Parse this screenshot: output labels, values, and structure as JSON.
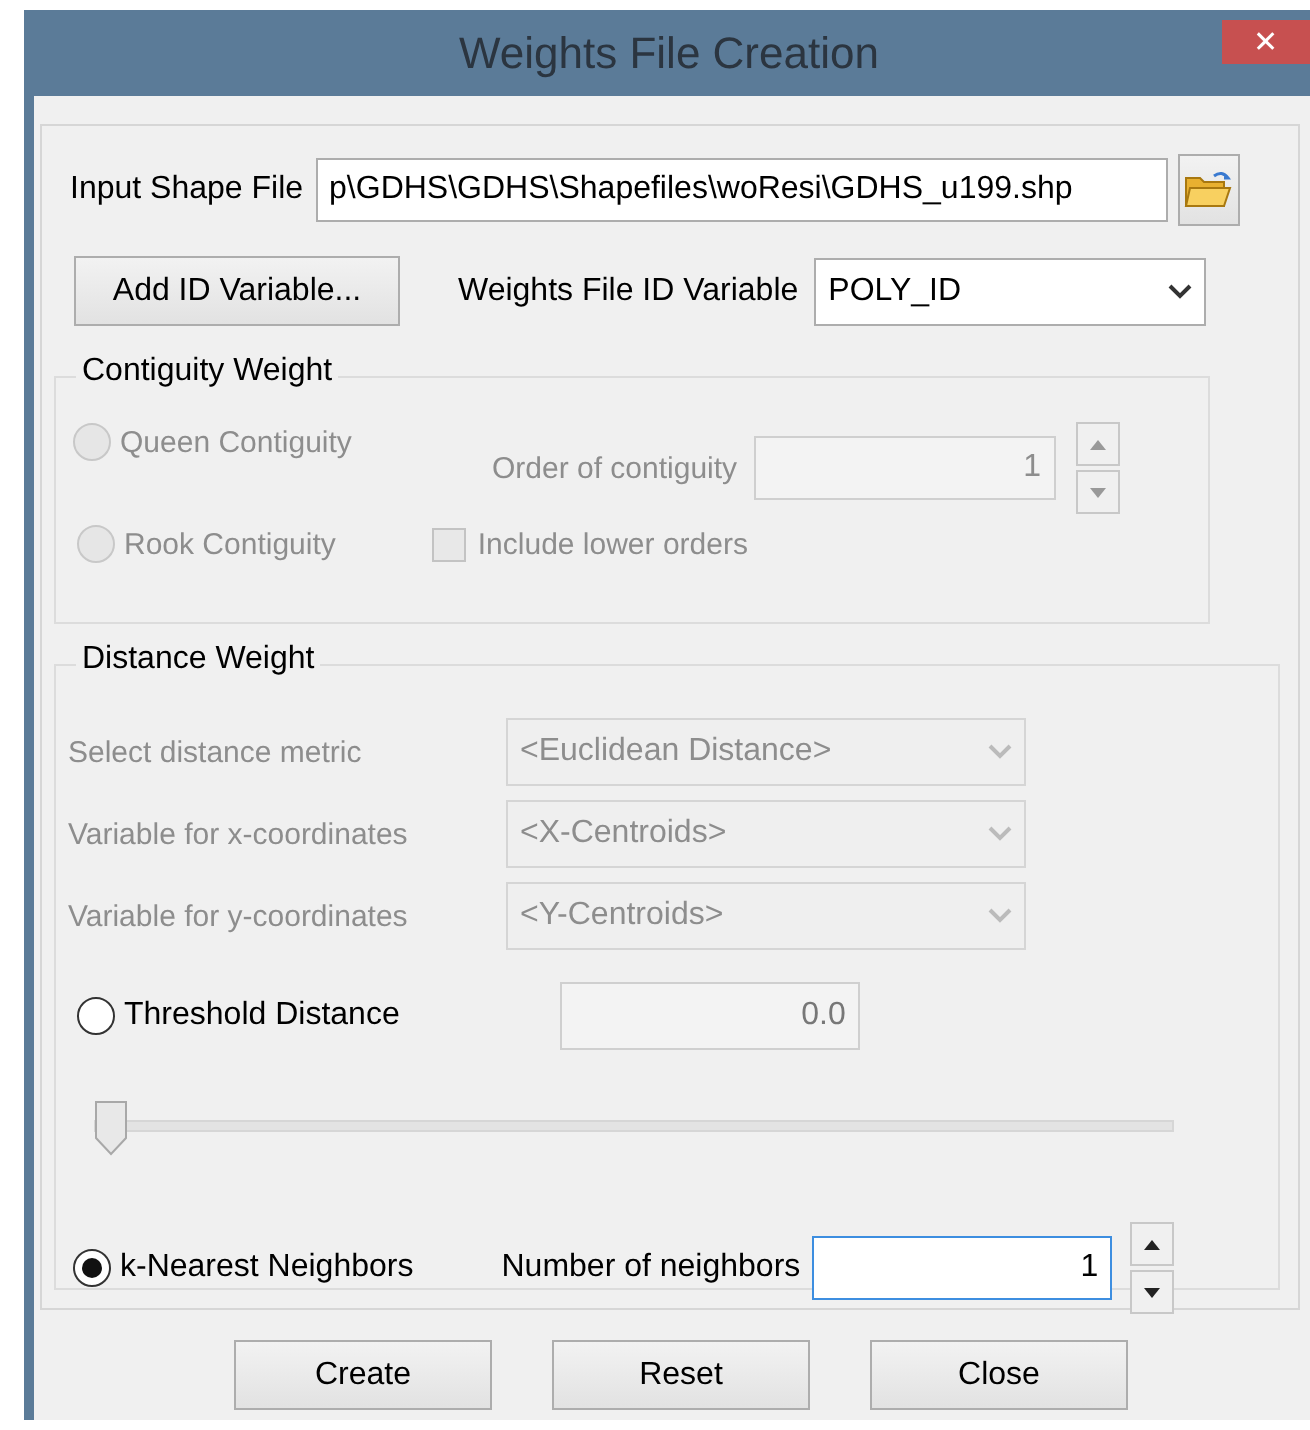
{
  "window": {
    "title": "Weights File Creation",
    "close": "✕"
  },
  "input_shape_file": {
    "label": "Input Shape File",
    "value": "p\\GDHS\\GDHS\\Shapefiles\\woResi\\GDHS_u199.shp"
  },
  "add_id_button": "Add ID Variable...",
  "weights_id": {
    "label": "Weights File ID Variable",
    "value": "POLY_ID"
  },
  "contiguity": {
    "title": "Contiguity Weight",
    "disabled": true,
    "queen": {
      "label": "Queen Contiguity",
      "selected": false
    },
    "rook": {
      "label": "Rook Contiguity",
      "selected": false
    },
    "order": {
      "label": "Order of contiguity",
      "value": "1"
    },
    "include_lower": {
      "label": "Include lower orders",
      "checked": false
    }
  },
  "distance": {
    "title": "Distance Weight",
    "selects": [
      {
        "label": "Select distance metric",
        "value": "<Euclidean Distance>",
        "disabled": true
      },
      {
        "label": "Variable for x-coordinates",
        "value": "<X-Centroids>",
        "disabled": true
      },
      {
        "label": "Variable for y-coordinates",
        "value": "<Y-Centroids>",
        "disabled": true
      }
    ],
    "threshold": {
      "label": "Threshold Distance",
      "selected": false,
      "value": "0.0",
      "level": 0
    },
    "knn": {
      "label": "k-Nearest Neighbors",
      "selected": true,
      "number_label": "Number of neighbors",
      "value": "1",
      "focused": true
    }
  },
  "buttons": [
    "Create",
    "Reset",
    "Close"
  ]
}
